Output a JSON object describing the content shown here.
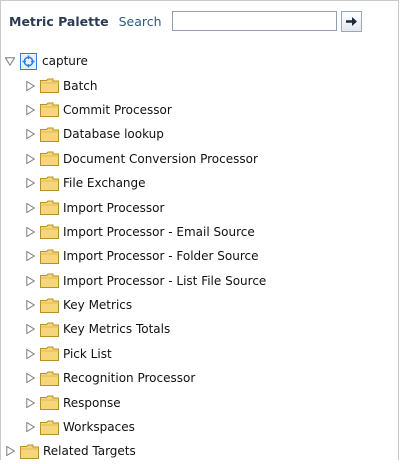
{
  "header": {
    "title": "Metric Palette",
    "search_label": "Search",
    "search_value": "",
    "go_icon": "arrow-right-icon"
  },
  "tree": {
    "root": {
      "label": "capture",
      "icon": "capture-root-icon",
      "expanded": true
    },
    "children": [
      {
        "label": "Batch"
      },
      {
        "label": "Commit Processor"
      },
      {
        "label": "Database lookup"
      },
      {
        "label": "Document Conversion Processor"
      },
      {
        "label": "File Exchange"
      },
      {
        "label": "Import Processor"
      },
      {
        "label": "Import Processor - Email Source"
      },
      {
        "label": "Import Processor - Folder Source"
      },
      {
        "label": "Import Processor - List File Source"
      },
      {
        "label": "Key Metrics"
      },
      {
        "label": "Key Metrics Totals"
      },
      {
        "label": "Pick List"
      },
      {
        "label": "Recognition Processor"
      },
      {
        "label": "Response"
      },
      {
        "label": "Workspaces"
      }
    ],
    "sibling": {
      "label": "Related Targets"
    }
  },
  "colors": {
    "title": "#2b3d53",
    "search_label": "#2f5a86",
    "folder_fill": "#f5d67a",
    "folder_stroke": "#b89024",
    "root_icon": "#2f7fd4"
  }
}
